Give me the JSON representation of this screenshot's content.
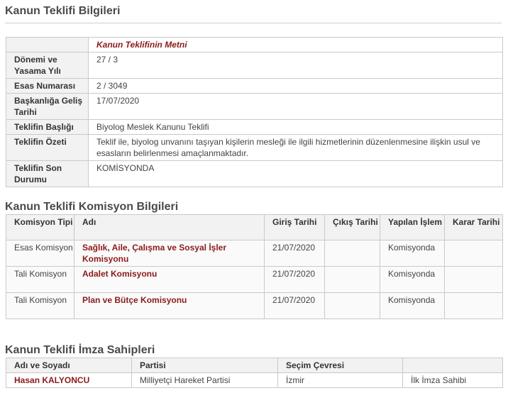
{
  "section1": {
    "title": "Kanun Teklifi Bilgileri",
    "text_link": "Kanun Teklifinin Metni",
    "rows": [
      {
        "label": "Dönemi ve Yasama Yılı",
        "value": "27 / 3"
      },
      {
        "label": "Esas Numarası",
        "value": "2 / 3049"
      },
      {
        "label": "Başkanlığa Geliş Tarihi",
        "value": "17/07/2020"
      },
      {
        "label": "Teklifin Başlığı",
        "value": "Biyolog Meslek Kanunu Teklifi"
      },
      {
        "label": "Teklifin Özeti",
        "value": "Teklif ile, biyolog unvanını taşıyan kişilerin mesleği ile ilgili hizmetlerinin düzenlenmesine ilişkin usul ve esasların belirlenmesi amaçlanmaktadır."
      },
      {
        "label": "Teklifin Son Durumu",
        "value": "KOMİSYONDA"
      }
    ]
  },
  "section2": {
    "title": "Kanun Teklifi Komisyon Bilgileri",
    "headers": [
      "Komisyon Tipi",
      "Adı",
      "Giriş Tarihi",
      "Çıkış Tarihi",
      "Yapılan İşlem",
      "Karar Tarihi"
    ],
    "rows": [
      {
        "type": "Esas Komisyon",
        "name": "Sağlık, Aile, Çalışma ve Sosyal İşler Komisyonu",
        "entry": "21/07/2020",
        "exit": "",
        "action": "Komisyonda",
        "decision": ""
      },
      {
        "type": "Tali Komisyon",
        "name": "Adalet Komisyonu",
        "entry": "21/07/2020",
        "exit": "",
        "action": "Komisyonda",
        "decision": ""
      },
      {
        "type": "Tali Komisyon",
        "name": "Plan ve Bütçe Komisyonu",
        "entry": "21/07/2020",
        "exit": "",
        "action": "Komisyonda",
        "decision": ""
      }
    ]
  },
  "section3": {
    "title": "Kanun Teklifi İmza Sahipleri",
    "headers": [
      "Adı ve Soyadı",
      "Partisi",
      "Seçim Çevresi",
      ""
    ],
    "rows": [
      {
        "name": "Hasan KALYONCU",
        "party": "Milliyetçi Hareket Partisi",
        "district": "İzmir",
        "role": "İlk İmza Sahibi"
      }
    ]
  }
}
